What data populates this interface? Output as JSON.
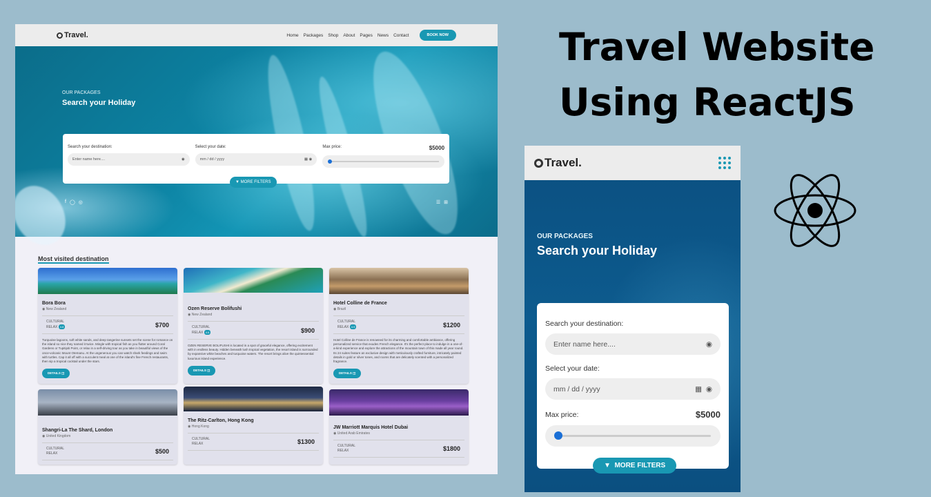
{
  "headline": {
    "line1": "Travel Website",
    "line2": "Using ReactJS"
  },
  "desktop": {
    "logo": "Travel.",
    "nav_links": [
      "Home",
      "Packages",
      "Shop",
      "About",
      "Pages",
      "News",
      "Contact"
    ],
    "book_button": "BOOK NOW",
    "hero": {
      "kicker": "OUR PACKAGES",
      "title": "Search your Holiday",
      "destination_label": "Search your destination:",
      "destination_placeholder": "Enter name here....",
      "date_label": "Select your date:",
      "date_value": "mm / dd / yyyy",
      "price_label": "Max price:",
      "price_value": "$5000",
      "price_slider_fraction": 0.0,
      "filters_button": "MORE FILTERS"
    },
    "section_title_a": "Most visited ",
    "section_title_b": "destination",
    "cards": [
      {
        "title": "Bora Bora",
        "location": "New Zealand",
        "tag1": "CULTURAL",
        "tag2": "RELAX",
        "price": "$700",
        "desc": "Turquoise lagoons, soft white sands, and deep tangerine sunsets set the scene for romance on the island so nice they named it twice. Mingle with tropical fish as you flutter around Coral Gardens or Tupitipiti Point, or relax in a self-driving tour as you take in beautiful views of the once-volcanic Mount Otemanu. At the ungenerous you can watch shark feedings and swim with turtles. Cap it all off with a succulent meal at one of the island's fine French restaurants, then sip a tropical cocktail under the stars.",
        "button": "DETAILS",
        "img": "bora"
      },
      {
        "title": "Ozen Reserve Bolifushi",
        "location": "New Zealand",
        "tag1": "CULTURAL",
        "tag2": "RELAX",
        "price": "$900",
        "desc": "OZEN RESERVE BOLIFUSHI is located in a spot of graceful elegance, offering excitement with in endless beauty. Hidden beneath lush tropical vegetation, the resort island is surrounded by expansive white beaches and turquoise waters. The resort brings alive the quintessential luxurious island experience.",
        "button": "DETAILS",
        "img": "ozen"
      },
      {
        "title": "Hotel Colline de France",
        "location": "Brazil",
        "tag1": "CULTURAL",
        "tag2": "RELAX",
        "price": "$1200",
        "desc": "Hotel Colline de France is renowned for its charming and comfortable ambiance, offering personalized service that exudes French elegance. It's the perfect place to indulge in a one-of-a-kind experience and explore the attractions of the mountain town of this made all year round. Its 24 suites feature an exclusive design with meticulously crafted furniture, intricately painted details in gold or silver tones, and rooms that are delicately scented with a personalized fragrance.",
        "button": "DETAILS",
        "img": "colline"
      },
      {
        "title": "Shangri-La The Shard, London",
        "location": "United Kingdom",
        "tag1": "CULTURAL",
        "tag2": "RELAX",
        "price": "$500",
        "img": "shard"
      },
      {
        "title": "The Ritz-Carlton, Hong Kong",
        "location": "Hong Kong",
        "tag1": "CULTURAL",
        "tag2": "RELAX",
        "price": "$1300",
        "img": "ritz"
      },
      {
        "title": "JW Marriott Marquis Hotel Dubai",
        "location": "United Arab Emirates",
        "tag1": "CULTURAL",
        "tag2": "RELAX",
        "price": "$1800",
        "img": "jw"
      }
    ]
  },
  "mobile": {
    "logo": "Travel.",
    "kicker": "OUR PACKAGES",
    "title": "Search your Holiday",
    "destination_label": "Search your destination:",
    "destination_placeholder": "Enter name here....",
    "date_label": "Select your date:",
    "date_value": "mm / dd / yyyy",
    "price_label": "Max price:",
    "price_value": "$5000",
    "price_slider_fraction": 0.0,
    "filters_button": "MORE FILTERS"
  },
  "icons": {
    "logo": "magnifier-logo-icon",
    "location": "location-pin-icon",
    "calendar": "calendar-icon",
    "filter": "funnel-icon",
    "menu": "grid-menu-icon",
    "react": "react-atom-icon"
  },
  "colors": {
    "accent": "#1998b3",
    "slider_thumb": "#1a6fd6",
    "background": "#9cbccc"
  }
}
